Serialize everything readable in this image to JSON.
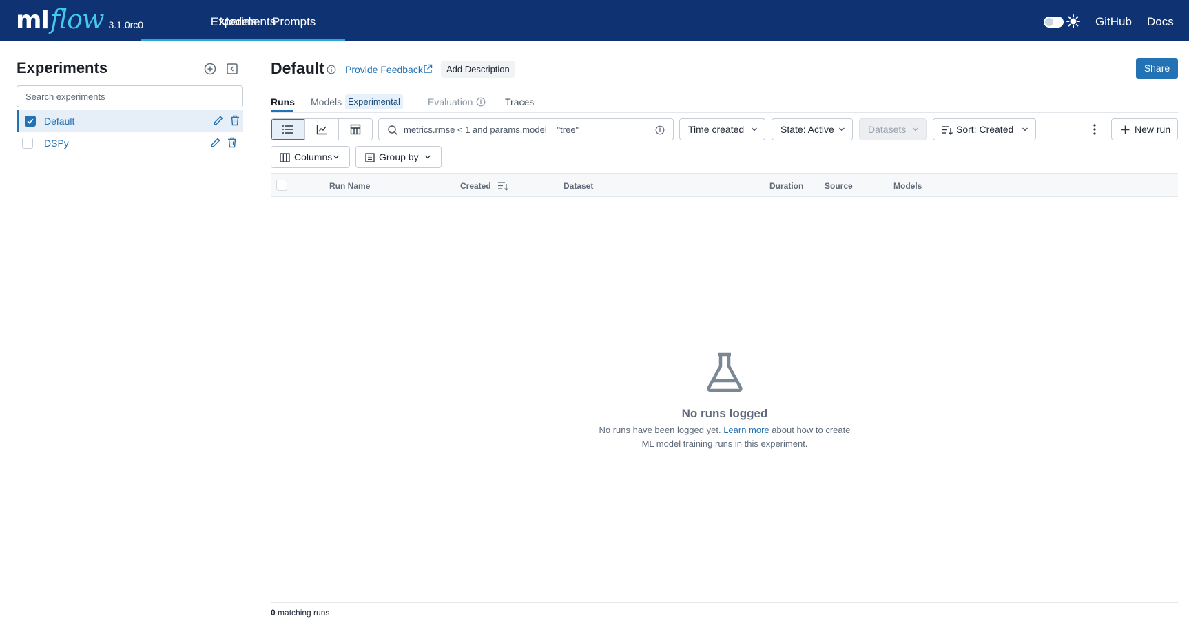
{
  "app": {
    "logo_ml": "ml",
    "logo_flow": "flow",
    "version": "3.1.0rc0",
    "nav": [
      {
        "label": "Experiments",
        "active": true
      },
      {
        "label": "Models",
        "active": false
      },
      {
        "label": "Prompts",
        "active": false
      }
    ],
    "links": {
      "github": "GitHub",
      "docs": "Docs"
    },
    "colors": {
      "header_bg": "#0e3272",
      "accent": "#2272b4",
      "nav_active": "#2aa8d9"
    }
  },
  "sidebar": {
    "title": "Experiments",
    "search_placeholder": "Search experiments",
    "items": [
      {
        "label": "Default",
        "checked": true,
        "selected": true
      },
      {
        "label": "DSPy",
        "checked": false,
        "selected": false
      }
    ]
  },
  "main": {
    "title": "Default",
    "feedback_label": "Provide Feedback",
    "add_description_label": "Add Description",
    "share_label": "Share",
    "tabs": [
      {
        "label": "Runs",
        "active": true
      },
      {
        "label": "Models",
        "tag": "Experimental"
      },
      {
        "label": "Evaluation",
        "disabled": true
      },
      {
        "label": "Traces"
      }
    ],
    "toolbar": {
      "search_placeholder": "metrics.rmse < 1 and params.model = \"tree\"",
      "time_created": "Time created",
      "state": "State: Active",
      "datasets": "Datasets",
      "sort": "Sort: Created",
      "new_run": "New run",
      "columns": "Columns",
      "group_by": "Group by"
    },
    "table": {
      "columns": [
        "Run Name",
        "Created",
        "Dataset",
        "Duration",
        "Source",
        "Models"
      ]
    },
    "empty": {
      "title": "No runs logged",
      "desc_before": "No runs have been logged yet.",
      "link": "Learn more",
      "desc_after": "about how to create ML model training runs in this experiment."
    },
    "footer": {
      "count": "0",
      "suffix": "matching runs"
    }
  }
}
